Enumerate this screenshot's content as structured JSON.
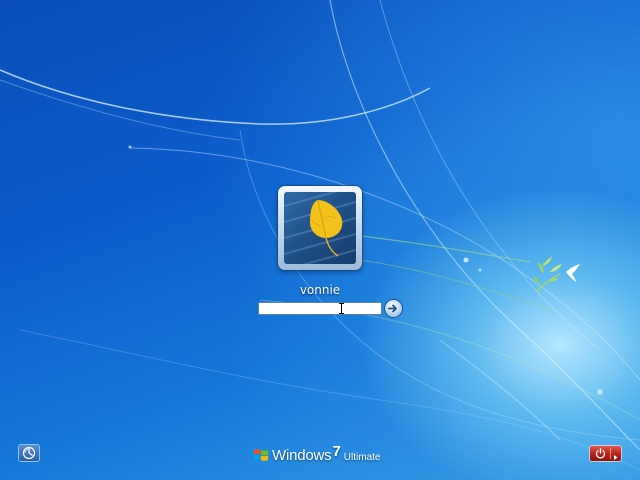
{
  "login": {
    "username": "vonnie",
    "password_value": "",
    "submit_label": "Submit"
  },
  "branding": {
    "name": "Windows",
    "version": "7",
    "edition": "Ultimate"
  },
  "icons": {
    "avatar": "leaf-user-picture",
    "submit": "arrow-right-icon",
    "ease_of_access": "ease-of-access-icon",
    "shutdown": "power-icon",
    "logo": "windows-flag-logo",
    "decoration": "bird-branch-icon"
  },
  "colors": {
    "background": "#0b5cc8",
    "shutdown": "#c0281f",
    "accent_light": "#bfe9ff"
  }
}
